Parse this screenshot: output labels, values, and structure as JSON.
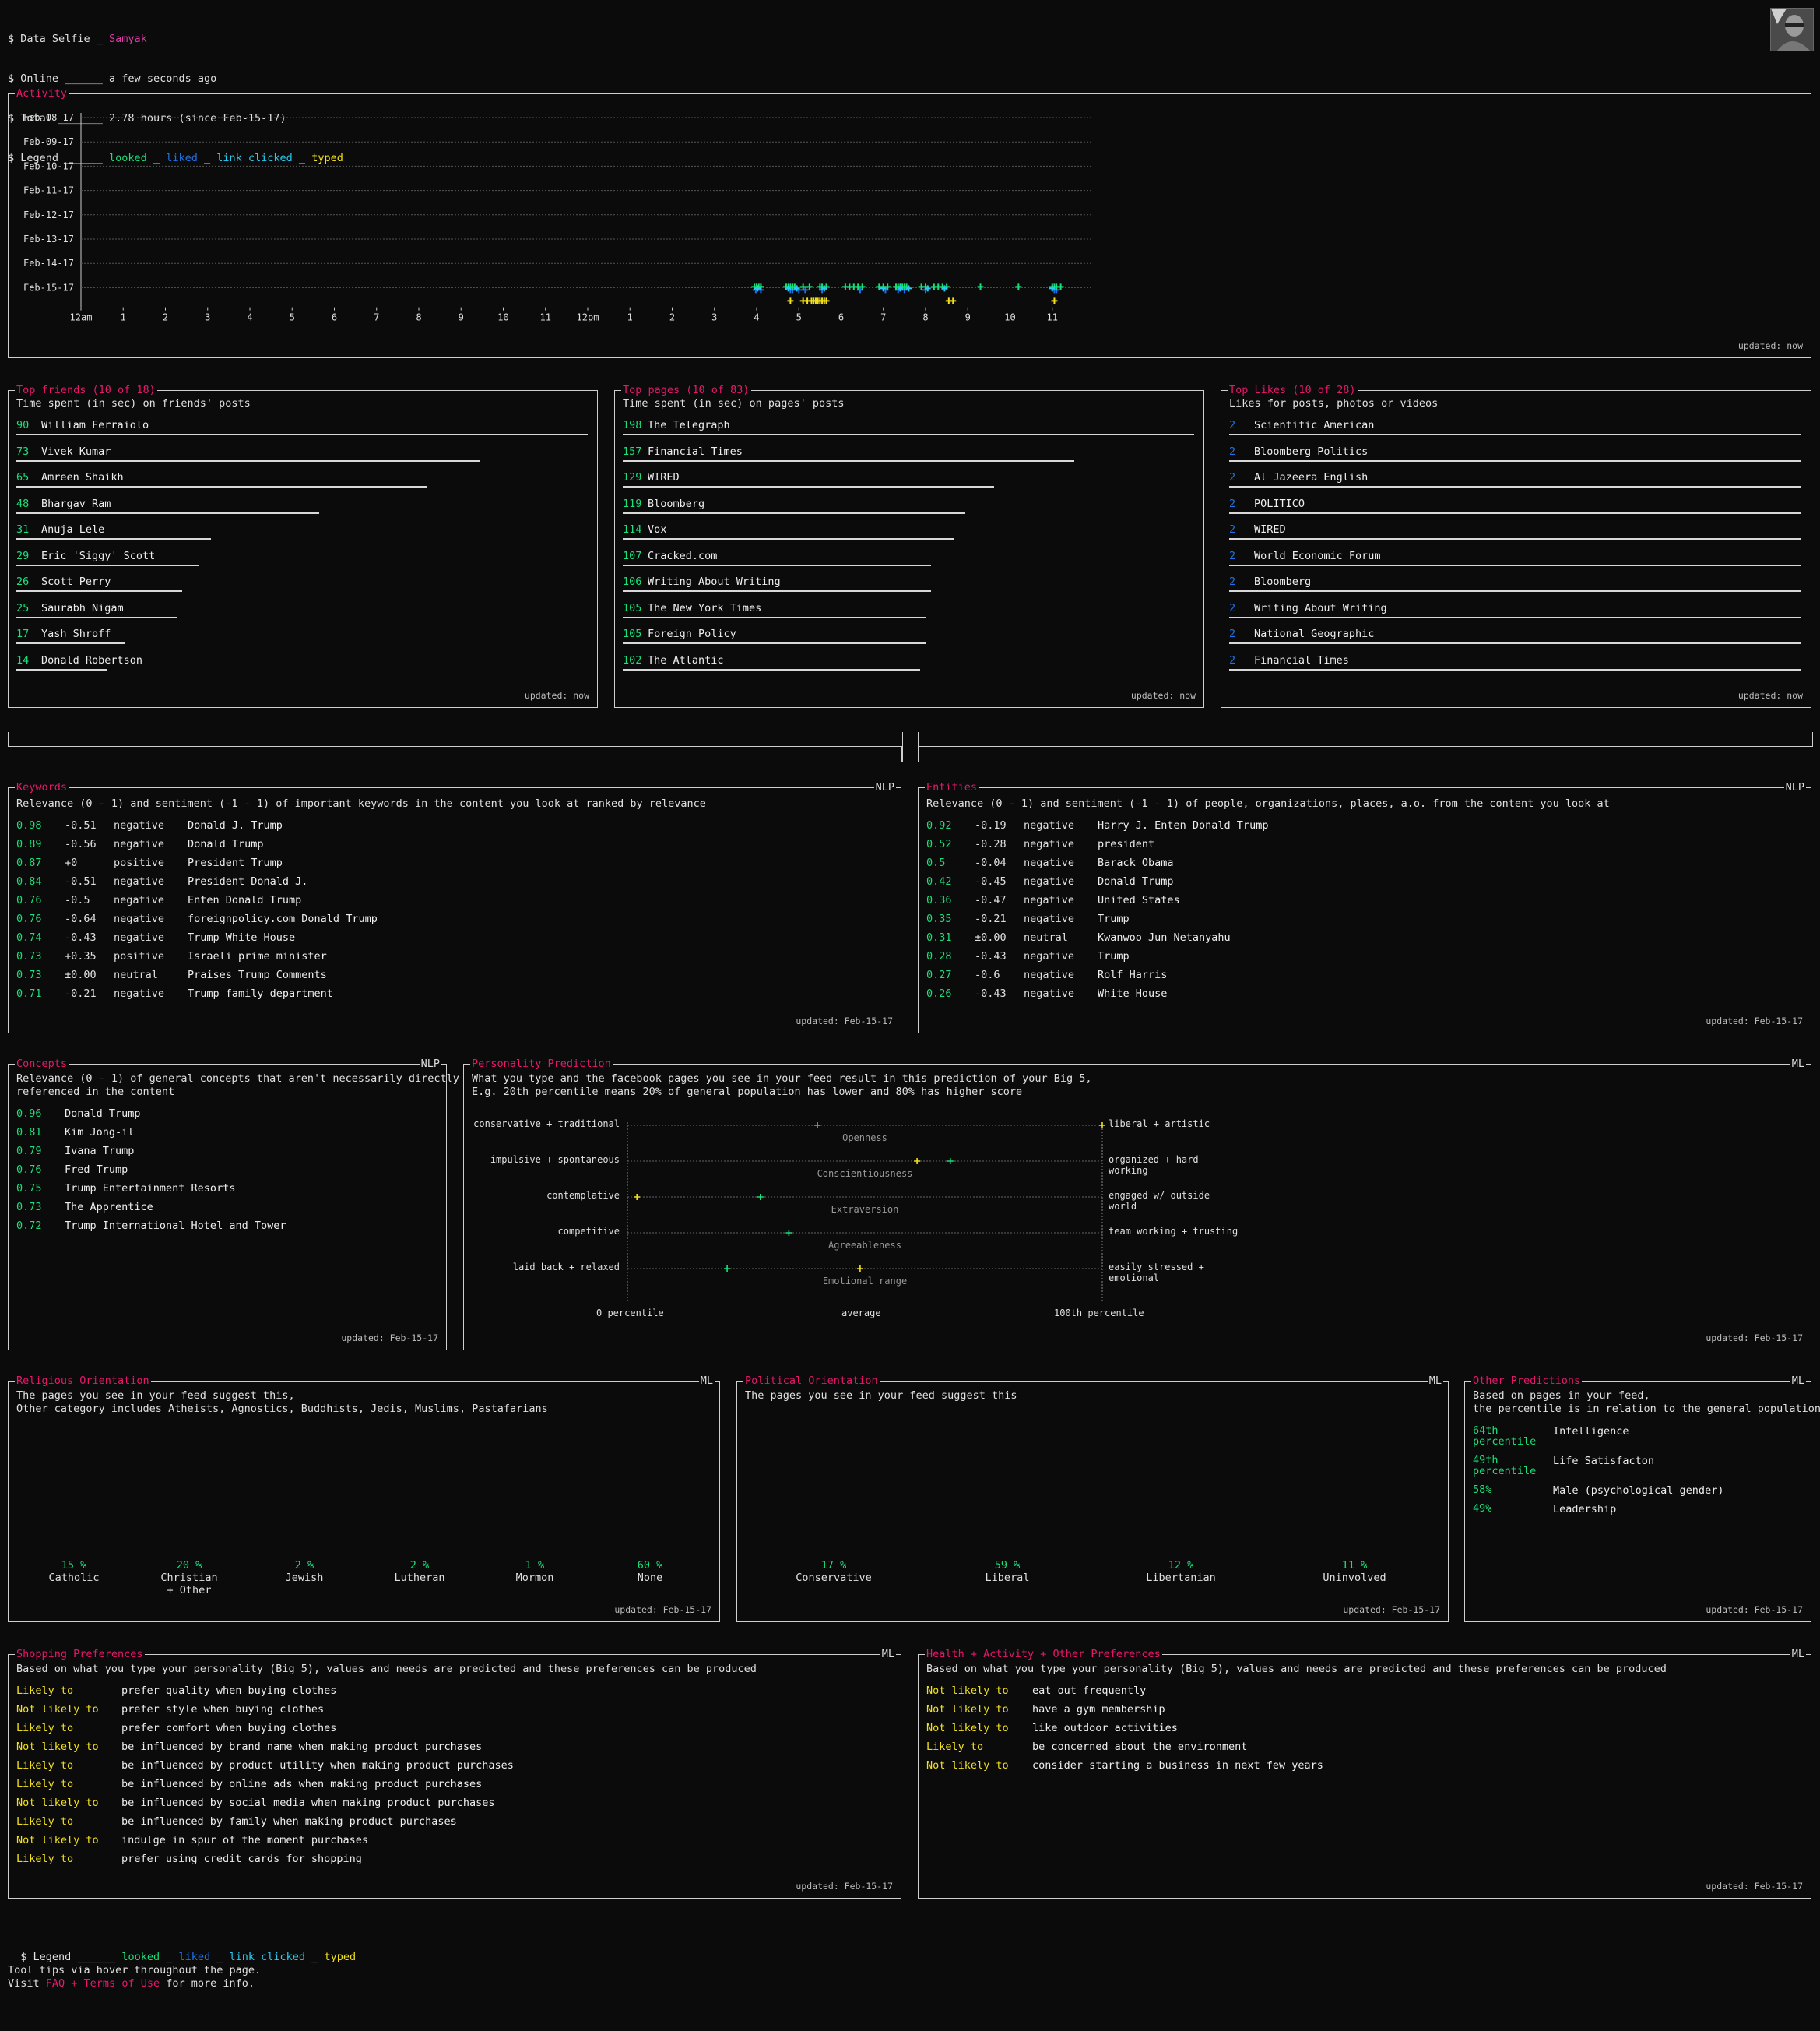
{
  "header": {
    "line1_prefix": "$ Data Selfie _ ",
    "user_name": "Samyak",
    "line2_prefix": "$ Online ______ ",
    "online_value": "a few seconds ago",
    "line3_prefix": "$ Total _______ ",
    "total_value": "2.78 hours (since Feb-15-17)",
    "line4_prefix": "$ Legend ______ ",
    "legend_looked": "looked",
    "legend_sep": " _ ",
    "legend_liked": "liked",
    "legend_link": "link clicked",
    "legend_typed": "typed"
  },
  "colors": {
    "accent": "#e8176b",
    "looked": "#19e07a",
    "liked": "#1e73e8",
    "link_clicked": "#29c9f0",
    "typed": "#f2e01b"
  },
  "activity": {
    "title": "Activity",
    "updated": "updated: now",
    "days": [
      "Feb-08-17",
      "Feb-09-17",
      "Feb-10-17",
      "Feb-11-17",
      "Feb-12-17",
      "Feb-13-17",
      "Feb-14-17",
      "Feb-15-17"
    ],
    "hours": [
      "12am",
      "1",
      "2",
      "3",
      "4",
      "5",
      "6",
      "7",
      "8",
      "9",
      "10",
      "11",
      "12pm",
      "1",
      "2",
      "3",
      "4",
      "5",
      "6",
      "7",
      "8",
      "9",
      "10",
      "11"
    ],
    "looked_hours": [
      15.95,
      16.0,
      16.05,
      16.1,
      16.1,
      16.7,
      16.75,
      16.8,
      16.85,
      16.9,
      17.1,
      17.25,
      17.5,
      17.55,
      17.65,
      18.1,
      18.2,
      18.3,
      18.4,
      18.5,
      18.9,
      19.0,
      19.1,
      19.3,
      19.35,
      19.4,
      19.45,
      19.5,
      19.55,
      19.9,
      20.0,
      20.2,
      20.3,
      20.4,
      20.5,
      21.3,
      22.2,
      23.0,
      23.05,
      23.1,
      23.2
    ],
    "liked_hours": [
      15.98,
      16.1,
      16.8,
      16.85,
      17.0,
      17.15,
      17.55,
      18.45,
      19.05,
      19.35,
      19.5,
      20.0,
      23.05,
      23.1
    ],
    "link_hours": [
      16.02,
      16.75,
      16.95,
      17.6,
      19.0,
      19.4,
      19.6,
      20.05,
      20.45,
      23.0
    ],
    "typed_hours": [
      16.8,
      17.1,
      17.2,
      17.3,
      17.35,
      17.4,
      17.45,
      17.5,
      17.55,
      17.6,
      17.65,
      20.55,
      20.65,
      23.05
    ]
  },
  "top_friends": {
    "title": "Top friends (10 of 18)",
    "desc": "Time spent (in sec) on friends' posts",
    "updated": "updated: now",
    "items": [
      {
        "value": "90",
        "name": "William Ferraiolo",
        "frac": 1.0
      },
      {
        "value": "73",
        "name": "Vivek Kumar",
        "frac": 0.81
      },
      {
        "value": "65",
        "name": "Amreen Shaikh",
        "frac": 0.72
      },
      {
        "value": "48",
        "name": "Bhargav Ram",
        "frac": 0.53
      },
      {
        "value": "31",
        "name": "Anuja Lele",
        "frac": 0.34
      },
      {
        "value": "29",
        "name": "Eric 'Siggy' Scott",
        "frac": 0.32
      },
      {
        "value": "26",
        "name": "Scott Perry",
        "frac": 0.29
      },
      {
        "value": "25",
        "name": "Saurabh Nigam",
        "frac": 0.28
      },
      {
        "value": "17",
        "name": "Yash Shroff",
        "frac": 0.19
      },
      {
        "value": "14",
        "name": "Donald Robertson",
        "frac": 0.16
      }
    ]
  },
  "top_pages": {
    "title": "Top pages (10 of 83)",
    "desc": "Time spent (in sec) on pages' posts",
    "updated": "updated: now",
    "items": [
      {
        "value": "198",
        "name": "The Telegraph",
        "frac": 1.0
      },
      {
        "value": "157",
        "name": "Financial Times",
        "frac": 0.79
      },
      {
        "value": "129",
        "name": "WIRED",
        "frac": 0.65
      },
      {
        "value": "119",
        "name": "Bloomberg",
        "frac": 0.6
      },
      {
        "value": "114",
        "name": "Vox",
        "frac": 0.58
      },
      {
        "value": "107",
        "name": "Cracked.com",
        "frac": 0.54
      },
      {
        "value": "106",
        "name": "Writing About Writing",
        "frac": 0.54
      },
      {
        "value": "105",
        "name": "The New York Times",
        "frac": 0.53
      },
      {
        "value": "105",
        "name": "Foreign Policy",
        "frac": 0.53
      },
      {
        "value": "102",
        "name": "The Atlantic",
        "frac": 0.52
      }
    ]
  },
  "top_likes": {
    "title": "Top Likes (10 of 28)",
    "desc": "Likes for posts, photos or videos",
    "updated": "updated: now",
    "items": [
      {
        "value": "2",
        "name": "Scientific American",
        "frac": 1.0
      },
      {
        "value": "2",
        "name": "Bloomberg Politics",
        "frac": 1.0
      },
      {
        "value": "2",
        "name": "Al Jazeera English",
        "frac": 1.0
      },
      {
        "value": "2",
        "name": "POLITICO",
        "frac": 1.0
      },
      {
        "value": "2",
        "name": "WIRED",
        "frac": 1.0
      },
      {
        "value": "2",
        "name": "World Economic Forum",
        "frac": 1.0
      },
      {
        "value": "2",
        "name": "Bloomberg",
        "frac": 1.0
      },
      {
        "value": "2",
        "name": "Writing About Writing",
        "frac": 1.0
      },
      {
        "value": "2",
        "name": "National Geographic",
        "frac": 1.0
      },
      {
        "value": "2",
        "name": "Financial Times",
        "frac": 1.0
      }
    ]
  },
  "keywords": {
    "title": "Keywords",
    "tag": "NLP",
    "desc": "Relevance (0 - 1) and sentiment (-1 - 1) of important keywords in the content you look at ranked by relevance",
    "updated": "updated: Feb-15-17",
    "items": [
      {
        "rel": "0.98",
        "sent": "-0.51",
        "label": "negative",
        "text": "Donald J. Trump"
      },
      {
        "rel": "0.89",
        "sent": "-0.56",
        "label": "negative",
        "text": "Donald Trump"
      },
      {
        "rel": "0.87",
        "sent": "+0",
        "label": "positive",
        "text": "President Trump"
      },
      {
        "rel": "0.84",
        "sent": "-0.51",
        "label": "negative",
        "text": "President Donald J."
      },
      {
        "rel": "0.76",
        "sent": "-0.5",
        "label": "negative",
        "text": "Enten Donald Trump"
      },
      {
        "rel": "0.76",
        "sent": "-0.64",
        "label": "negative",
        "text": "foreignpolicy.com Donald Trump"
      },
      {
        "rel": "0.74",
        "sent": "-0.43",
        "label": "negative",
        "text": "Trump White House"
      },
      {
        "rel": "0.73",
        "sent": "+0.35",
        "label": "positive",
        "text": "Israeli prime minister"
      },
      {
        "rel": "0.73",
        "sent": "±0.00",
        "label": "neutral",
        "text": "Praises Trump Comments"
      },
      {
        "rel": "0.71",
        "sent": "-0.21",
        "label": "negative",
        "text": "Trump family department"
      }
    ]
  },
  "entities": {
    "title": "Entities",
    "tag": "NLP",
    "desc": "Relevance (0 - 1) and sentiment (-1 - 1) of people, organizations, places, a.o. from the content you look at",
    "updated": "updated: Feb-15-17",
    "items": [
      {
        "rel": "0.92",
        "sent": "-0.19",
        "label": "negative",
        "text": "Harry J. Enten Donald Trump"
      },
      {
        "rel": "0.52",
        "sent": "-0.28",
        "label": "negative",
        "text": "president"
      },
      {
        "rel": "0.5",
        "sent": "-0.04",
        "label": "negative",
        "text": "Barack Obama"
      },
      {
        "rel": "0.42",
        "sent": "-0.45",
        "label": "negative",
        "text": "Donald Trump"
      },
      {
        "rel": "0.36",
        "sent": "-0.47",
        "label": "negative",
        "text": "United States"
      },
      {
        "rel": "0.35",
        "sent": "-0.21",
        "label": "negative",
        "text": "Trump"
      },
      {
        "rel": "0.31",
        "sent": "±0.00",
        "label": "neutral",
        "text": "Kwanwoo Jun Netanyahu"
      },
      {
        "rel": "0.28",
        "sent": "-0.43",
        "label": "negative",
        "text": "Trump"
      },
      {
        "rel": "0.27",
        "sent": "-0.6",
        "label": "negative",
        "text": "Rolf Harris"
      },
      {
        "rel": "0.26",
        "sent": "-0.43",
        "label": "negative",
        "text": "White House"
      }
    ]
  },
  "concepts": {
    "title": "Concepts",
    "tag": "NLP",
    "desc": "Relevance (0 - 1) of general concepts that aren't necessarily directly\nreferenced in the content",
    "updated": "updated: Feb-15-17",
    "items": [
      {
        "rel": "0.96",
        "text": "Donald Trump"
      },
      {
        "rel": "0.81",
        "text": "Kim Jong-il"
      },
      {
        "rel": "0.79",
        "text": "Ivana Trump"
      },
      {
        "rel": "0.76",
        "text": "Fred Trump"
      },
      {
        "rel": "0.75",
        "text": "Trump Entertainment Resorts"
      },
      {
        "rel": "0.73",
        "text": "The Apprentice"
      },
      {
        "rel": "0.72",
        "text": "Trump International Hotel and Tower"
      }
    ]
  },
  "personality": {
    "title": "Personality Prediction",
    "tag": "ML",
    "desc": "What you type and the facebook pages you see in your feed result in this prediction of your Big 5,\nE.g. 20th percentile means 20% of general population has lower and 80% has higher score",
    "updated": "updated: Feb-15-17",
    "axis_left": "0 percentile",
    "axis_mid": "average",
    "axis_right": "100th percentile",
    "traits": [
      {
        "left": "conservative + traditional",
        "right": "liberal + artistic",
        "name": "Openness",
        "green": 40,
        "yellow": 100
      },
      {
        "left": "impulsive + spontaneous",
        "right": "organized + hard working",
        "name": "Conscientiousness",
        "green": 68,
        "yellow": 61
      },
      {
        "left": "contemplative",
        "right": "engaged w/ outside world",
        "name": "Extraversion",
        "green": 28,
        "yellow": 2
      },
      {
        "left": "competitive",
        "right": "team working + trusting",
        "name": "Agreeableness",
        "green": 34,
        "yellow": null
      },
      {
        "left": "laid back + relaxed",
        "right": "easily stressed + emotional",
        "name": "Emotional range",
        "green": 21,
        "yellow": 49
      }
    ]
  },
  "religious": {
    "title": "Religious Orientation",
    "tag": "ML",
    "desc": "The pages you see in your feed suggest this,\nOther category includes Atheists, Agnostics, Buddhists, Jedis, Muslims, Pastafarians",
    "updated": "updated: Feb-15-17",
    "items": [
      {
        "pct": "15 %",
        "label": "Catholic"
      },
      {
        "pct": "20 %",
        "label": "Christian\n+ Other"
      },
      {
        "pct": "2 %",
        "label": "Jewish"
      },
      {
        "pct": "2 %",
        "label": "Lutheran"
      },
      {
        "pct": "1 %",
        "label": "Mormon"
      },
      {
        "pct": "60 %",
        "label": "None"
      }
    ]
  },
  "political": {
    "title": "Political Orientation",
    "tag": "ML",
    "desc": "The pages you see in your feed suggest this",
    "updated": "updated: Feb-15-17",
    "items": [
      {
        "pct": "17 %",
        "label": "Conservative"
      },
      {
        "pct": "59 %",
        "label": "Liberal"
      },
      {
        "pct": "12 %",
        "label": "Libertanian"
      },
      {
        "pct": "11 %",
        "label": "Uninvolved"
      }
    ]
  },
  "other_predictions": {
    "title": "Other Predictions",
    "tag": "ML",
    "desc": "Based on pages in your feed,\nthe percentile is in relation to the general population",
    "updated": "updated: Feb-15-17",
    "items": [
      {
        "value": "64th\npercentile",
        "label": "Intelligence"
      },
      {
        "value": "49th\npercentile",
        "label": "Life Satisfacton"
      },
      {
        "value": "58%",
        "label": "Male (psychological gender)"
      },
      {
        "value": "49%",
        "label": "Leadership"
      }
    ]
  },
  "shopping": {
    "title": "Shopping Preferences",
    "tag": "ML",
    "desc": "Based on what you type your personality (Big 5), values and needs are predicted and these preferences can be produced",
    "updated": "updated: Feb-15-17",
    "items": [
      {
        "likely": "Likely to",
        "text": "prefer quality when buying clothes"
      },
      {
        "likely": "Not likely to",
        "text": "prefer style when buying clothes"
      },
      {
        "likely": "Likely to",
        "text": "prefer comfort when buying clothes"
      },
      {
        "likely": "Not likely to",
        "text": "be influenced by brand name when making product purchases"
      },
      {
        "likely": "Likely to",
        "text": "be influenced by product utility when making product purchases"
      },
      {
        "likely": "Likely to",
        "text": "be influenced by online ads when making product purchases"
      },
      {
        "likely": "Not likely to",
        "text": "be influenced by social media when making product purchases"
      },
      {
        "likely": "Likely to",
        "text": "be influenced by family when making product purchases"
      },
      {
        "likely": "Not likely to",
        "text": "indulge in spur of the moment purchases"
      },
      {
        "likely": "Likely to",
        "text": "prefer using credit cards for shopping"
      }
    ]
  },
  "health": {
    "title": "Health + Activity + Other Preferences",
    "tag": "ML",
    "desc": "Based on what you type your personality (Big 5), values and needs are predicted and these preferences can be produced",
    "updated": "updated: Feb-15-17",
    "items": [
      {
        "likely": "Not likely to",
        "text": "eat out frequently"
      },
      {
        "likely": "Not likely to",
        "text": "have a gym membership"
      },
      {
        "likely": "Not likely to",
        "text": "like outdoor activities"
      },
      {
        "likely": "Likely to",
        "text": "be concerned about the environment"
      },
      {
        "likely": "Not likely to",
        "text": "consider starting a business in next few years"
      }
    ]
  },
  "footer": {
    "legend_prefix": "$ Legend ______ ",
    "legend_looked": "looked",
    "legend_sep": " _ ",
    "legend_liked": "liked",
    "legend_link": "link clicked",
    "legend_typed": "typed",
    "tips": "Tool tips via hover throughout the page.",
    "visit_prefix": "Visit ",
    "faq_link": "FAQ + Terms of Use",
    "visit_suffix": " for more info."
  }
}
